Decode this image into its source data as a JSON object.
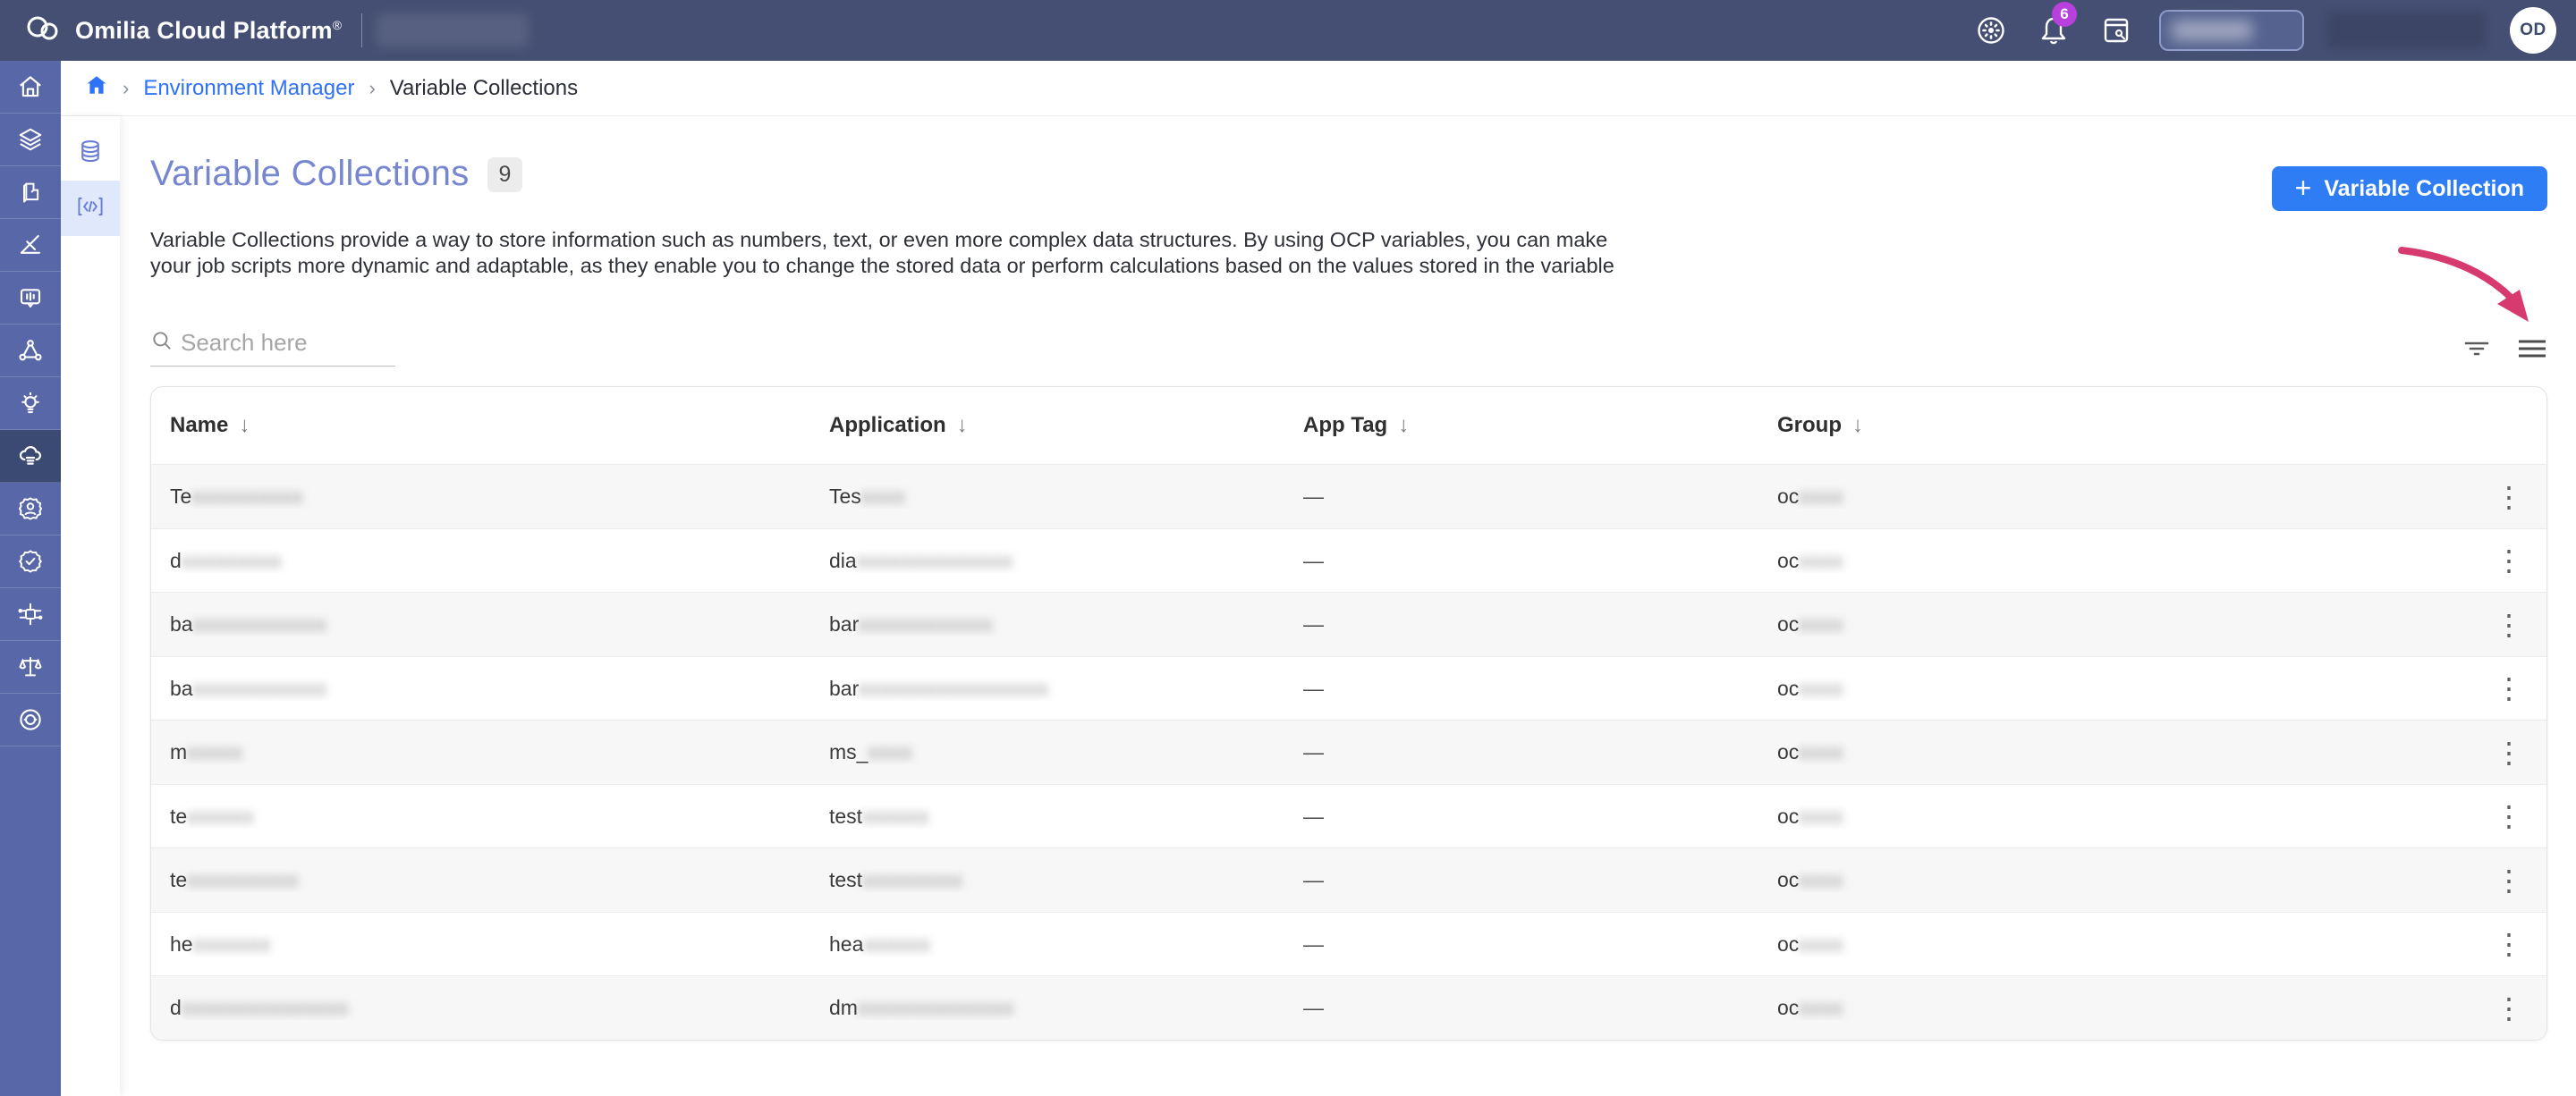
{
  "topbar": {
    "product_name": "Omilia Cloud Platform",
    "registered_mark": "®",
    "notification_count": "6",
    "avatar_initials": "OD"
  },
  "breadcrumb": {
    "separator": "›",
    "link": "Environment Manager",
    "current": "Variable Collections"
  },
  "page": {
    "title": "Variable Collections",
    "count_badge": "9",
    "description_line1": "Variable Collections provide a way to store information such as numbers, text, or even more complex data structures. By using OCP variables, you can make",
    "description_line2": "your job scripts more dynamic and adaptable, as they enable you to change the stored data or perform calculations based on the values stored in the variable"
  },
  "toolbar": {
    "add_button_plus": "+",
    "add_button_label": "Variable Collection",
    "search_placeholder": "Search here"
  },
  "table": {
    "columns": [
      "Name",
      "Application",
      "App Tag",
      "Group"
    ],
    "sort_arrow": "↓",
    "row_menu_icon": "⋮",
    "rows": [
      {
        "name_prefix": "Te",
        "name_redacted": "xxxxxxxxxx",
        "app_prefix": "Tes",
        "app_redacted": "xxxx",
        "app_tag": "—",
        "group_prefix": "oc",
        "group_redacted": "xxxx"
      },
      {
        "name_prefix": "d",
        "name_redacted": "xxxxxxxxx",
        "app_prefix": "dia",
        "app_redacted": "xxxxxxxxxxxxxx",
        "app_tag": "—",
        "group_prefix": "oc",
        "group_redacted": "xxxx"
      },
      {
        "name_prefix": "ba",
        "name_redacted": "xxxxxxxxxxxx",
        "app_prefix": "bar",
        "app_redacted": "xxxxxxxxxxxx",
        "app_tag": "—",
        "group_prefix": "oc",
        "group_redacted": "xxxx"
      },
      {
        "name_prefix": "ba",
        "name_redacted": "xxxxxxxxxxxx",
        "app_prefix": "bar",
        "app_redacted": "xxxxxxxxxxxxxxxxx",
        "app_tag": "—",
        "group_prefix": "oc",
        "group_redacted": "xxxx"
      },
      {
        "name_prefix": "m",
        "name_redacted": "xxxxx",
        "app_prefix": "ms_",
        "app_redacted": "xxxx",
        "app_tag": "—",
        "group_prefix": "oc",
        "group_redacted": "xxxx"
      },
      {
        "name_prefix": "te",
        "name_redacted": "xxxxxx",
        "app_prefix": "test",
        "app_redacted": "xxxxxx",
        "app_tag": "—",
        "group_prefix": "oc",
        "group_redacted": "xxxx"
      },
      {
        "name_prefix": "te",
        "name_redacted": "xxxxxxxxxx",
        "app_prefix": "test",
        "app_redacted": "xxxxxxxxx",
        "app_tag": "—",
        "group_prefix": "oc",
        "group_redacted": "xxxx"
      },
      {
        "name_prefix": "he",
        "name_redacted": "xxxxxxx",
        "app_prefix": "hea",
        "app_redacted": "xxxxxx",
        "app_tag": "—",
        "group_prefix": "oc",
        "group_redacted": "xxxx"
      },
      {
        "name_prefix": "d",
        "name_redacted": "xxxxxxxxxxxxxxx",
        "app_prefix": "dm",
        "app_redacted": "xxxxxxxxxxxxxx",
        "app_tag": "—",
        "group_prefix": "oc",
        "group_redacted": "xxxx"
      }
    ]
  },
  "icons": {
    "topbar": [
      "cloud-logo-icon",
      "settings-sun-icon",
      "bell-icon",
      "release-notes-icon"
    ],
    "sidebar": [
      "home-icon",
      "layers-icon",
      "block-icon",
      "set-square-icon",
      "voice-chat-icon",
      "network-icon",
      "lightbulb-icon",
      "cloud-env-icon",
      "gear-user-icon",
      "badge-check-icon",
      "chip-icon",
      "scale-icon",
      "lifebuoy-icon"
    ],
    "mini_sidebar": [
      "database-icon",
      "code-brackets-icon"
    ],
    "toolbar": [
      "search-icon",
      "filter-icon",
      "hamburger-icon"
    ],
    "row": [
      "kebab-menu-icon"
    ]
  },
  "colors": {
    "topbar": "#454f73",
    "sidebar": "#5767a8",
    "sidebar_selected": "#3b4a73",
    "accent_blue": "#2e7df4",
    "link_blue": "#2f72f5",
    "title_indigo": "#7787cf",
    "annotation_pink": "#d63a6e",
    "notification_badge": "#b840dd",
    "row_alt": "#f7f7f7"
  }
}
